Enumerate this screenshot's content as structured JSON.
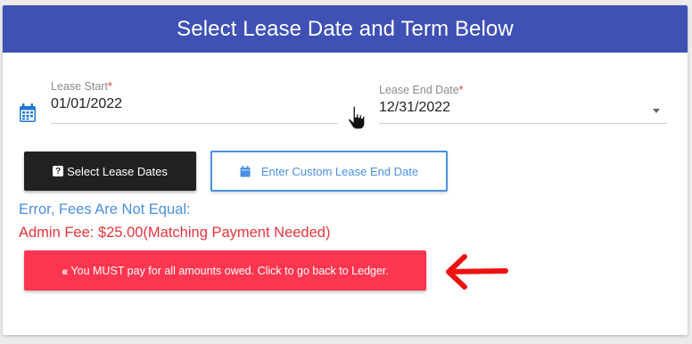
{
  "header": {
    "title": "Select Lease Date and Term Below"
  },
  "lease_start": {
    "label": "Lease Start",
    "required_mark": "*",
    "value": "01/01/2022"
  },
  "lease_end": {
    "label": "Lease End Date",
    "required_mark": "*",
    "value": "12/31/2022"
  },
  "buttons": {
    "select_dates": {
      "icon": "question-icon",
      "label": "Select Lease Dates"
    },
    "custom_end": {
      "icon": "calendar-icon",
      "label": "Enter Custom Lease End Date"
    },
    "pay_ledger": {
      "icon": "double-chevron-left-icon",
      "label": "You MUST pay for all amounts owed. Click to go back to Ledger."
    }
  },
  "error": {
    "title": "Error, Fees Are Not Equal:",
    "admin_fee": "Admin Fee: $25.00(Matching Payment Needed)"
  },
  "colors": {
    "header": "#3f51b5",
    "primary_blue": "#4a90e2",
    "error_red": "#e8343c",
    "danger_button": "#ff3650",
    "dark_button": "#212121"
  }
}
